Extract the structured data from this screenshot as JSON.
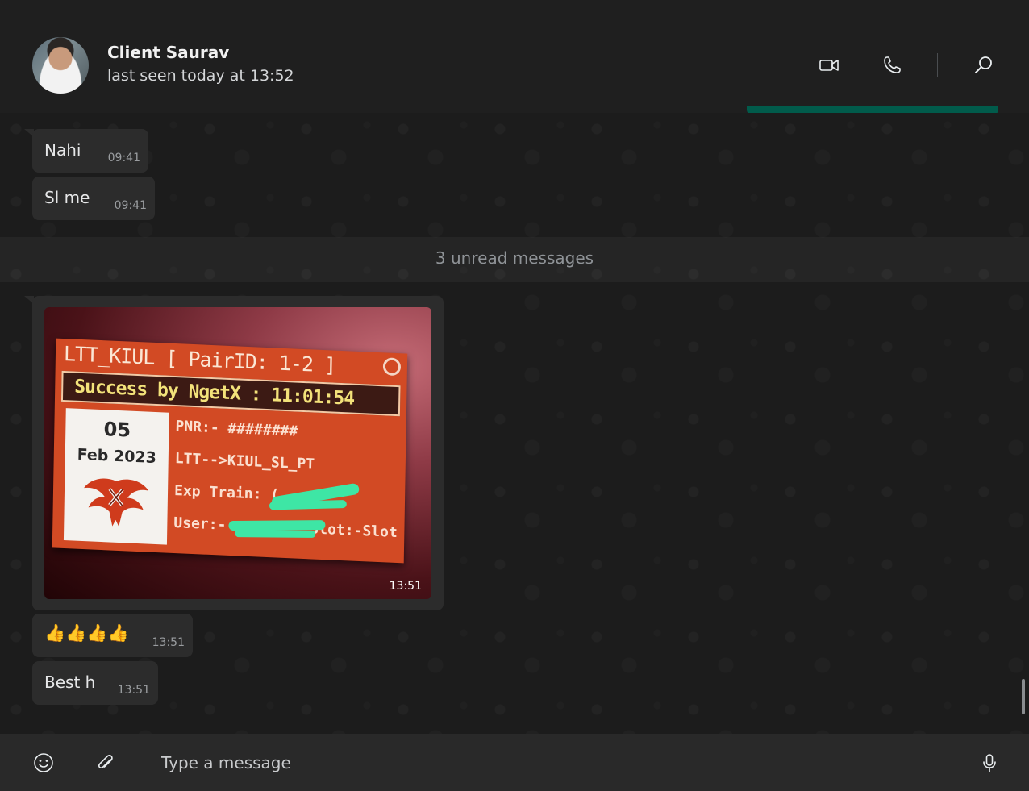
{
  "contact": {
    "name": "Client Saurav",
    "status": "last seen today at 13:52"
  },
  "header": {
    "icons": [
      "video-camera-icon",
      "phone-icon",
      "search-icon"
    ]
  },
  "messages": [
    {
      "type": "text",
      "text": "Nahi",
      "time": "09:41"
    },
    {
      "type": "text",
      "text": "Sl me",
      "time": "09:41"
    },
    {
      "type": "image",
      "time": "13:51",
      "image_text": {
        "title": "LTT_KIUL [ PairID: 1-2 ]",
        "success": "Success by NgetX : 11:01:54",
        "day": "05",
        "month_year": "Feb 2023",
        "pnr": "PNR:- ########",
        "route": "LTT-->KIUL_SL_PT",
        "train": "Exp Train: (",
        "user": "User:-",
        "slot": "Slot:-Slot"
      }
    },
    {
      "type": "text",
      "text": "👍👍👍👍",
      "time": "13:51"
    },
    {
      "type": "text",
      "text": "Best h",
      "time": "13:51"
    }
  ],
  "unread_label": "3 unread messages",
  "composer": {
    "placeholder": "Type a message",
    "icons": [
      "emoji-icon",
      "paperclip-icon",
      "microphone-icon"
    ]
  },
  "colors": {
    "background": "#1f1f1f",
    "bubble": "#2c2c2c",
    "accent": "#015b4b",
    "footer": "#292929"
  }
}
